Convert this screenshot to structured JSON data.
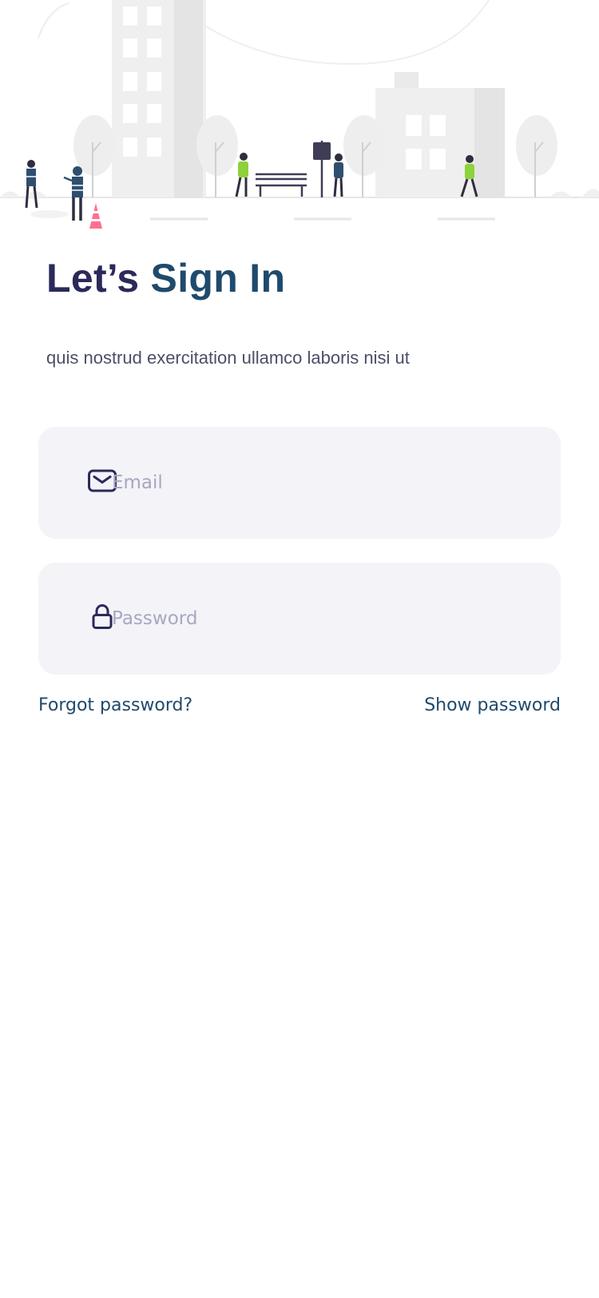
{
  "header": {
    "title_prefix": "Let’s ",
    "title_emphasis": "Sign In",
    "subtitle": "quis nostrud exercitation ullamco laboris nisi ut"
  },
  "form": {
    "email": {
      "placeholder": "Email",
      "value": "",
      "icon": "envelope-icon"
    },
    "password": {
      "placeholder": "Password",
      "value": "",
      "icon": "lock-icon"
    }
  },
  "links": {
    "forgot_password": "Forgot password?",
    "show_password": "Show password"
  },
  "colors": {
    "accent": "#1f4a6c",
    "title": "#2a2a5a",
    "field_bg": "#f3f3f8",
    "placeholder": "#a7a8c0",
    "figure_green": "#8ed13b",
    "cone_pink": "#ff6f91"
  }
}
